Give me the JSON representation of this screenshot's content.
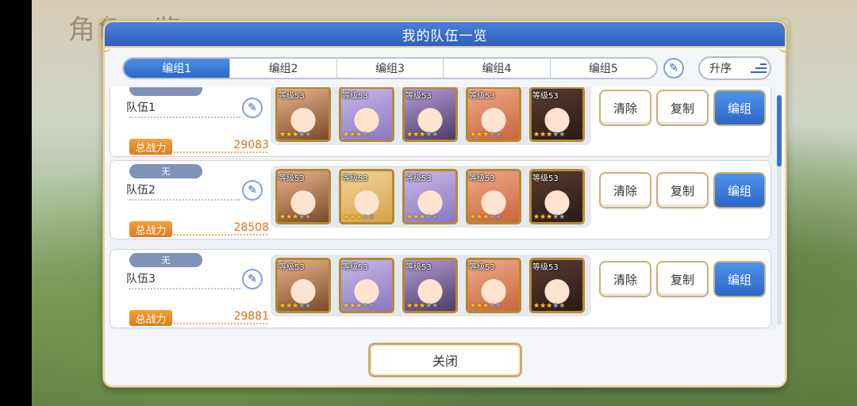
{
  "background": {
    "title": "角色一览"
  },
  "dialog": {
    "title": "我的队伍一览",
    "tabs": [
      "编组1",
      "编组2",
      "编组3",
      "编组4",
      "编组5"
    ],
    "active_tab": 0,
    "sort_label": "升序",
    "close_label": "关闭"
  },
  "teams": [
    {
      "badge": "",
      "name": "队伍1",
      "power_label": "总战力",
      "power": "29083",
      "members": [
        {
          "level": "等级53",
          "stars": 3
        },
        {
          "level": "等级53",
          "stars": 3
        },
        {
          "level": "等级53",
          "stars": 3
        },
        {
          "level": "等级53",
          "stars": 3
        },
        {
          "level": "等级53",
          "stars": 3
        }
      ],
      "buttons": {
        "clear": "清除",
        "copy": "复制",
        "edit": "编组"
      }
    },
    {
      "badge": "无",
      "name": "队伍2",
      "power_label": "总战力",
      "power": "28508",
      "members": [
        {
          "level": "等级53",
          "stars": 3
        },
        {
          "level": "等级53",
          "stars": 3
        },
        {
          "level": "等级53",
          "stars": 3
        },
        {
          "level": "等级53",
          "stars": 3
        },
        {
          "level": "等级53",
          "stars": 3
        }
      ],
      "buttons": {
        "clear": "清除",
        "copy": "复制",
        "edit": "编组"
      }
    },
    {
      "badge": "无",
      "name": "队伍3",
      "power_label": "总战力",
      "power": "29881",
      "members": [
        {
          "level": "等级53",
          "stars": 3
        },
        {
          "level": "等级53",
          "stars": 3
        },
        {
          "level": "等级53",
          "stars": 3
        },
        {
          "level": "等级53",
          "stars": 3
        },
        {
          "level": "等级53",
          "stars": 3
        }
      ],
      "buttons": {
        "clear": "清除",
        "copy": "复制",
        "edit": "编组"
      }
    }
  ],
  "colors": {
    "header_blue": "#2f5fbd",
    "accent_orange": "#e07a18",
    "gold_border": "#c9b27a"
  }
}
